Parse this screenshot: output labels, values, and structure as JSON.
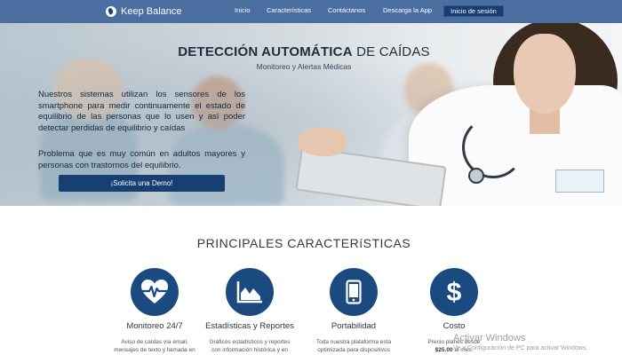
{
  "navbar": {
    "brand": "Keep Balance",
    "links": [
      "Inicio",
      "Características",
      "Contáctanos",
      "Descarga la App"
    ],
    "login_label": "Inicio de sesión"
  },
  "hero": {
    "title_bold": "DETECCIÓN AUTOMÁTICA",
    "title_rest": " DE CAÍDAS",
    "subtitle": "Monitoreo y Alertas Médicas",
    "paragraph1": "Nuestros sistemas utilizan los sensores de los smartphone para medir continuamente el estado de equilibrio de las personas que lo usen y así poder detectar perdidas de equilibrio y caídas",
    "paragraph2": "Problema que es muy común en adultos mayores y personas con trastornos del equilibrio.",
    "demo_button": "¡Solicita una Demo!"
  },
  "features": {
    "title": "PRINCIPALES CARACTERíSTICAS",
    "items": [
      {
        "icon": "heartbeat-icon",
        "title": "Monitoreo 24/7",
        "desc_line1": "Aviso de caídas vía email,",
        "desc_line2": "mensajes de texto y llamada en"
      },
      {
        "icon": "area-chart-icon",
        "title": "Estadísticas y Reportes",
        "desc_line1": "Gráficos estadísticos y reportes",
        "desc_line2": "con información histórica y en"
      },
      {
        "icon": "mobile-phone-icon",
        "title": "Portabilidad",
        "desc_line1": "Toda nuestra plataforma esta",
        "desc_line2": "optimizada para dispositivos"
      },
      {
        "icon": "dollar-icon",
        "title": "Costo",
        "desc_line1": "Precio planes desde",
        "desc_price": "$25.00",
        "desc_line2_rest": " al mes."
      }
    ]
  },
  "watermark": {
    "line1": "Activar Windows",
    "line2": "Ve a Configuración de PC para activar Windows."
  },
  "colors": {
    "navbar": "#4a6ea0",
    "accent_dark": "#1b4a80",
    "button": "#183f72"
  }
}
